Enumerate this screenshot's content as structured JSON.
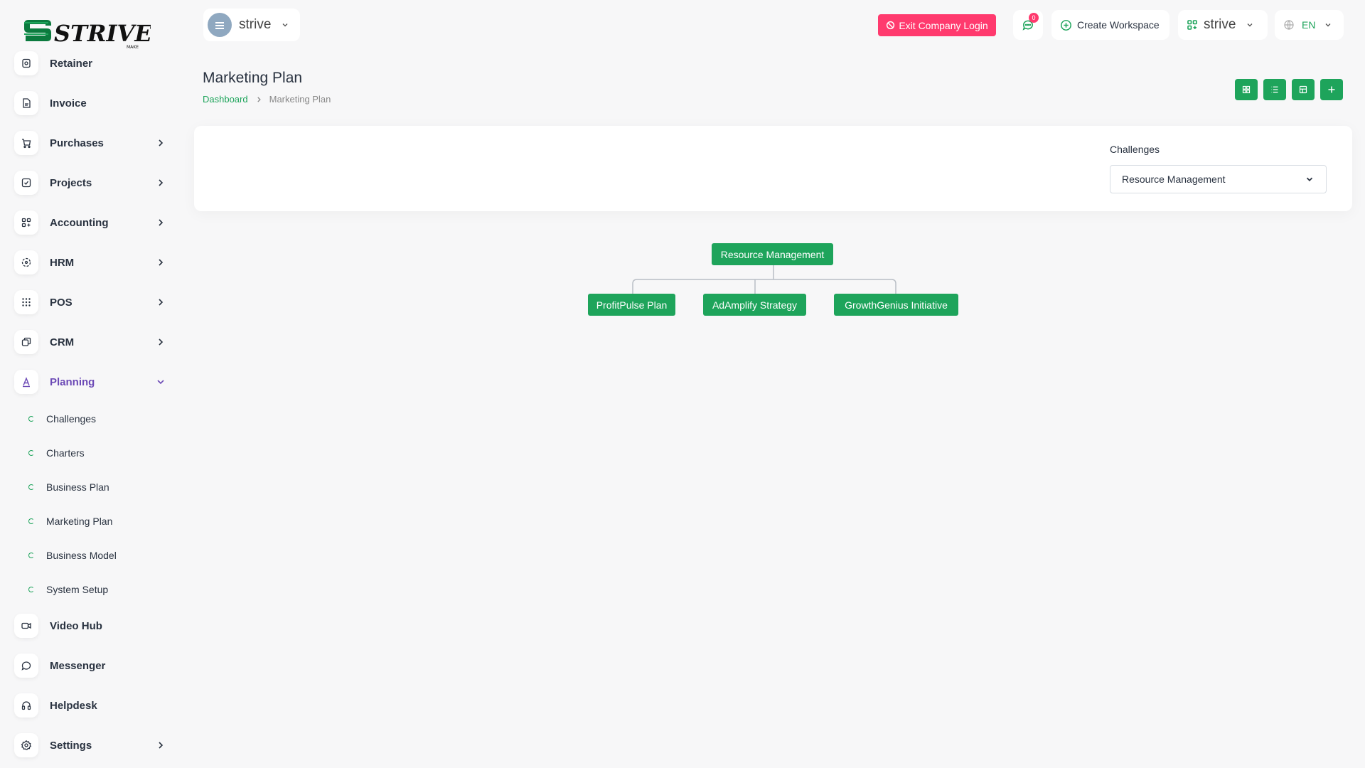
{
  "brand": {
    "logo_text": "STRIVE",
    "logo_sub": "MAKE"
  },
  "sidebar": {
    "items": [
      {
        "label": "Retainer",
        "icon": "retainer-icon"
      },
      {
        "label": "Invoice",
        "icon": "invoice-icon"
      },
      {
        "label": "Purchases",
        "icon": "cart-icon"
      },
      {
        "label": "Projects",
        "icon": "checkbox-icon"
      },
      {
        "label": "Accounting",
        "icon": "apps-icon"
      },
      {
        "label": "HRM",
        "icon": "hrm-icon"
      },
      {
        "label": "POS",
        "icon": "grid-dots-icon"
      },
      {
        "label": "CRM",
        "icon": "crm-icon"
      },
      {
        "label": "Planning",
        "icon": "planning-icon"
      },
      {
        "label": "Video Hub",
        "icon": "video-icon"
      },
      {
        "label": "Messenger",
        "icon": "message-icon"
      },
      {
        "label": "Helpdesk",
        "icon": "headset-icon"
      },
      {
        "label": "Settings",
        "icon": "gear-icon"
      }
    ],
    "planning_sub": [
      "Challenges",
      "Charters",
      "Business Plan",
      "Marketing Plan",
      "Business Model",
      "System Setup"
    ]
  },
  "header": {
    "workspace_name": "strive",
    "exit_label": "Exit Company Login",
    "chat_count": "0",
    "create_workspace": "Create Workspace",
    "workspace_select": "strive",
    "language": "EN"
  },
  "page": {
    "title": "Marketing Plan",
    "breadcrumb_home": "Dashboard",
    "breadcrumb_current": "Marketing Plan"
  },
  "filter": {
    "label": "Challenges",
    "selected": "Resource Management"
  },
  "org_chart": {
    "root": "Resource Management",
    "children": [
      "ProfitPulse Plan",
      "AdAmplify Strategy",
      "GrowthGenius Initiative"
    ]
  },
  "colors": {
    "accent": "#1ea45b",
    "danger": "#ff3a6e",
    "active": "#6c4ab6"
  }
}
